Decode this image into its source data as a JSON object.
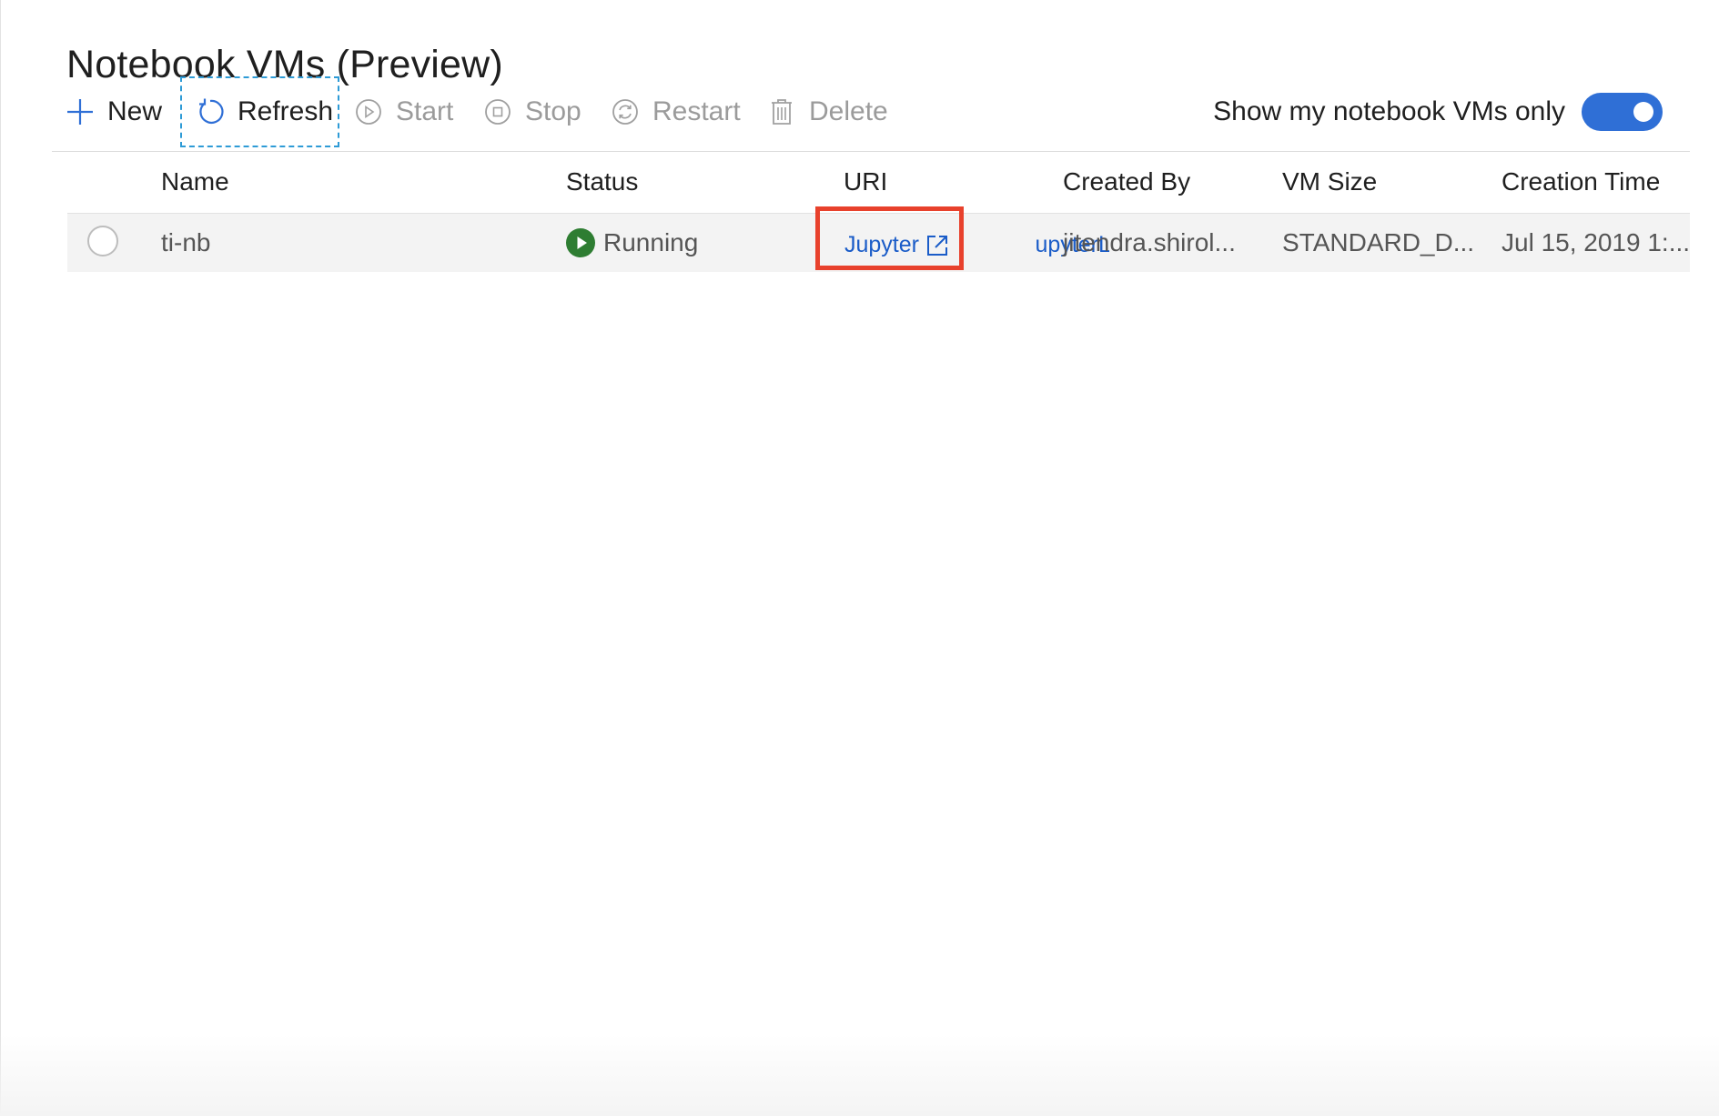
{
  "page": {
    "title": "Notebook VMs (Preview)"
  },
  "toolbar": {
    "new_label": "New",
    "refresh_label": "Refresh",
    "start_label": "Start",
    "stop_label": "Stop",
    "restart_label": "Restart",
    "delete_label": "Delete",
    "toggle_label": "Show my notebook VMs only",
    "toggle_on": true
  },
  "table": {
    "columns": [
      "Name",
      "Status",
      "URI",
      "Created By",
      "VM Size",
      "Creation Time"
    ],
    "rows": [
      {
        "name": "ti-nb",
        "status": "Running",
        "uri_jupyter": "Jupyter",
        "uri_jupyterlab": "JupyterL",
        "created_by": "jitendra.shirol...",
        "vm_size": "STANDARD_D...",
        "creation_time": "Jul 15, 2019 1:..."
      }
    ]
  },
  "icons": {
    "new": "plus-icon",
    "refresh": "refresh-icon",
    "start": "play-circle-icon",
    "stop": "stop-circle-icon",
    "restart": "restart-icon",
    "delete": "trash-icon",
    "status": "running-status-icon",
    "external": "external-link-icon"
  },
  "colors": {
    "accent": "#2f6fd6",
    "link": "#1a5cc8",
    "running": "#2e7d32",
    "highlight": "#e8412c",
    "focus_dash": "#2e9bd6"
  }
}
